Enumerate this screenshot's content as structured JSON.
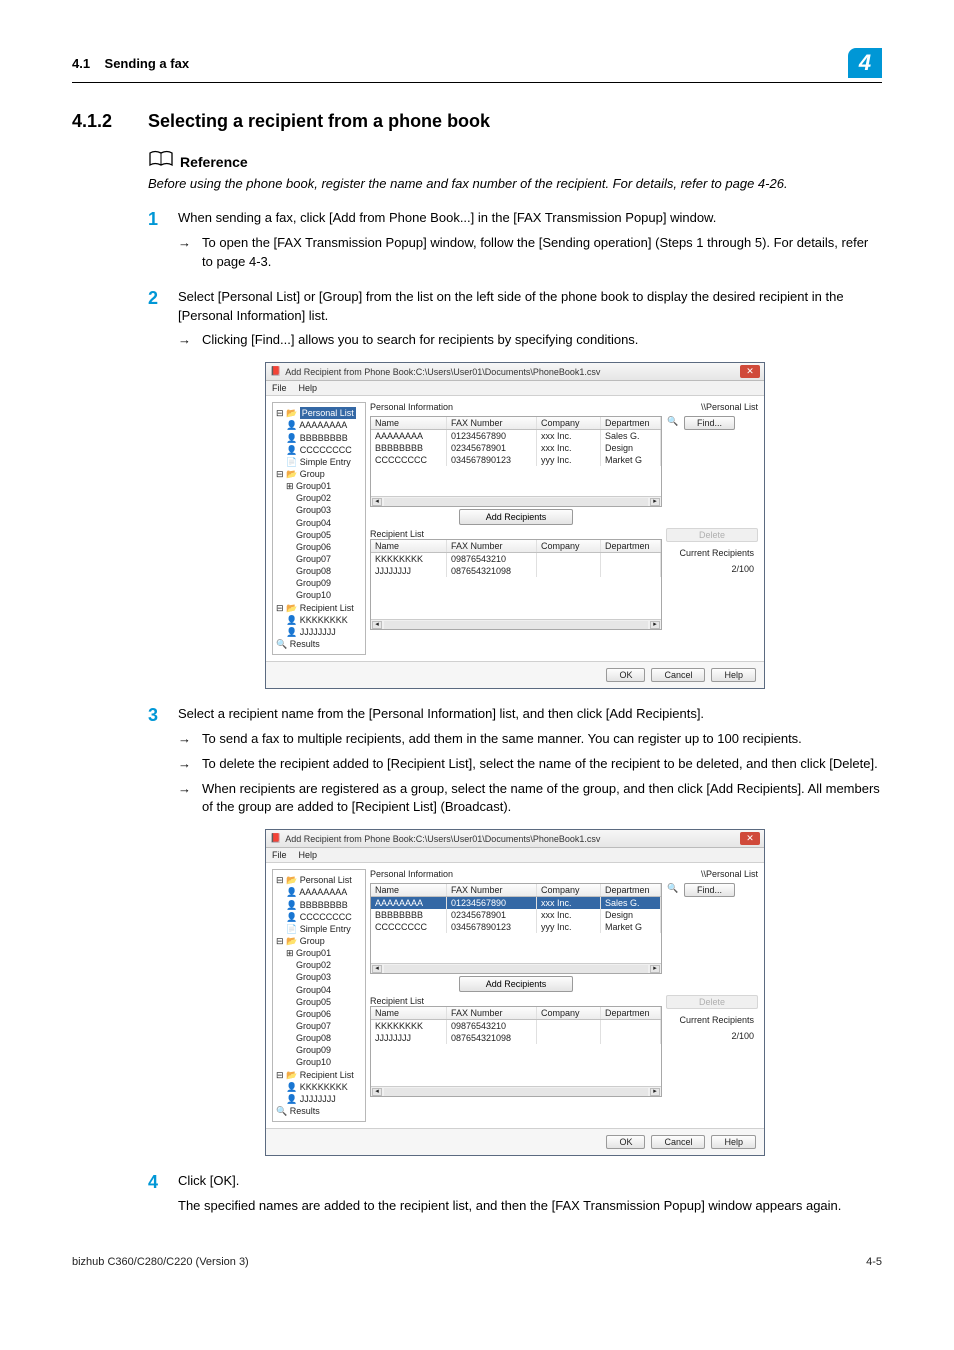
{
  "header": {
    "section_num": "4.1",
    "section_title": "Sending a fax",
    "chapter_num": "4"
  },
  "section": {
    "num": "4.1.2",
    "title": "Selecting a recipient from a phone book"
  },
  "reference": {
    "label": "Reference",
    "text": "Before using the phone book, register the name and fax number of the recipient. For details, refer to page 4-26."
  },
  "steps": {
    "s1": {
      "num": "1",
      "text": "When sending a fax, click [Add from Phone Book...] in the [FAX Transmission Popup] window.",
      "sub1": "To open the [FAX Transmission Popup] window, follow the [Sending operation] (Steps 1 through 5). For details, refer to page 4-3."
    },
    "s2": {
      "num": "2",
      "text": "Select [Personal List] or [Group] from the list on the left side of the phone book to display the desired recipient in the [Personal Information] list.",
      "sub1": "Clicking [Find...] allows you to search for recipients by specifying conditions."
    },
    "s3": {
      "num": "3",
      "text": "Select a recipient name from the [Personal Information] list, and then click [Add Recipients].",
      "sub1": "To send a fax to multiple recipients, add them in the same manner. You can register up to 100 recipients.",
      "sub2": "To delete the recipient added to [Recipient List], select the name of the recipient to be deleted, and then click [Delete].",
      "sub3": "When recipients are registered as a group, select the name of the group, and then click [Add Recipients]. All members of the group are added to [Recipient List] (Broadcast)."
    },
    "s4": {
      "num": "4",
      "text": "Click [OK].",
      "tail": "The specified names are added to the recipient list, and then the [FAX Transmission Popup] window appears again."
    }
  },
  "dialog": {
    "title": "Add Recipient from Phone Book:C:\\Users\\User01\\Documents\\PhoneBook1.csv",
    "menu_file": "File",
    "menu_help": "Help",
    "tree": {
      "personal": "Personal List",
      "aaa": "AAAAAAAA",
      "bbb": "BBBBBBBB",
      "ccc": "CCCCCCCC",
      "simple": "Simple Entry",
      "group": "Group",
      "g1": "Group01",
      "g2": "Group02",
      "g3": "Group03",
      "g4": "Group04",
      "g5": "Group05",
      "g6": "Group06",
      "g7": "Group07",
      "g8": "Group08",
      "g9": "Group09",
      "g10": "Group10",
      "recp": "Recipient List",
      "kkk": "KKKKKKKK",
      "jjj": "JJJJJJJJ",
      "results": "Results"
    },
    "pane_personal": "Personal Information",
    "path_personal": "\\\\Personal List",
    "find": "Find...",
    "cols": {
      "name": "Name",
      "fax": "FAX Number",
      "comp": "Company",
      "dept": "Departmen"
    },
    "rows": [
      {
        "name": "AAAAAAAA",
        "fax": "01234567890",
        "comp": "xxx Inc.",
        "dept": "Sales G."
      },
      {
        "name": "BBBBBBBB",
        "fax": "02345678901",
        "comp": "xxx Inc.",
        "dept": "Design"
      },
      {
        "name": "CCCCCCCC",
        "fax": "034567890123",
        "comp": "yyy Inc.",
        "dept": "Market G"
      }
    ],
    "add_recipients": "Add Recipients",
    "recipient_list": "Recipient List",
    "delete": "Delete",
    "rrows": [
      {
        "name": "KKKKKKKK",
        "fax": "09876543210",
        "comp": "",
        "dept": ""
      },
      {
        "name": "JJJJJJJJ",
        "fax": "087654321098",
        "comp": "",
        "dept": ""
      }
    ],
    "current_recipients": "Current Recipients",
    "count": "2/100",
    "ok": "OK",
    "cancel": "Cancel",
    "help": "Help"
  },
  "footer": {
    "left": "bizhub C360/C280/C220 (Version 3)",
    "right": "4-5"
  }
}
